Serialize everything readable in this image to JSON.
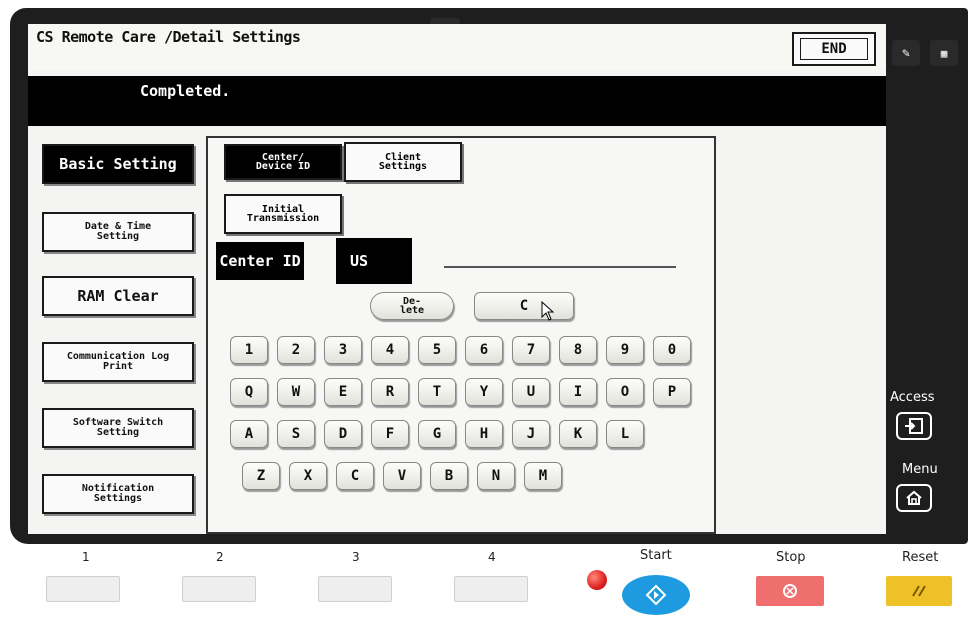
{
  "header": {
    "title": "CS Remote Care  /Detail Settings",
    "end_label": "END",
    "status_message": "Completed."
  },
  "menu": [
    {
      "label": "Basic Setting",
      "active": true
    },
    {
      "label": "Date & Time Setting"
    },
    {
      "label": "RAM Clear"
    },
    {
      "label": "Communication Log Print"
    },
    {
      "label": "Software Switch Setting"
    },
    {
      "label": "Notification Settings"
    }
  ],
  "panel": {
    "tabs": {
      "center_device_id": "Center/ Device ID",
      "client_settings": "Client Settings",
      "initial_transmission": "Initial Transmission"
    },
    "center_id_label": "Center ID",
    "center_id_value": "US",
    "delete_key": "De- lete",
    "clear_key": "C",
    "keys_row1": [
      "1",
      "2",
      "3",
      "4",
      "5",
      "6",
      "7",
      "8",
      "9",
      "0"
    ],
    "keys_row2": [
      "Q",
      "W",
      "E",
      "R",
      "T",
      "Y",
      "U",
      "I",
      "O",
      "P"
    ],
    "keys_row3": [
      "A",
      "S",
      "D",
      "F",
      "G",
      "H",
      "J",
      "K",
      "L"
    ],
    "keys_row4": [
      "Z",
      "X",
      "C",
      "V",
      "B",
      "N",
      "M"
    ]
  },
  "side": {
    "pen_icon": "pencil-icon",
    "keypad_icon": "keypad-icon",
    "access_label": "Access",
    "menu_label": "Menu"
  },
  "hardware": {
    "registers": [
      "1",
      "2",
      "3",
      "4"
    ],
    "start_label": "Start",
    "stop_label": "Stop",
    "reset_label": "Reset",
    "colors": {
      "start": "#1e9be0",
      "stop": "#ef6e6e",
      "reset": "#efc128",
      "indicator": "#e02020"
    }
  }
}
